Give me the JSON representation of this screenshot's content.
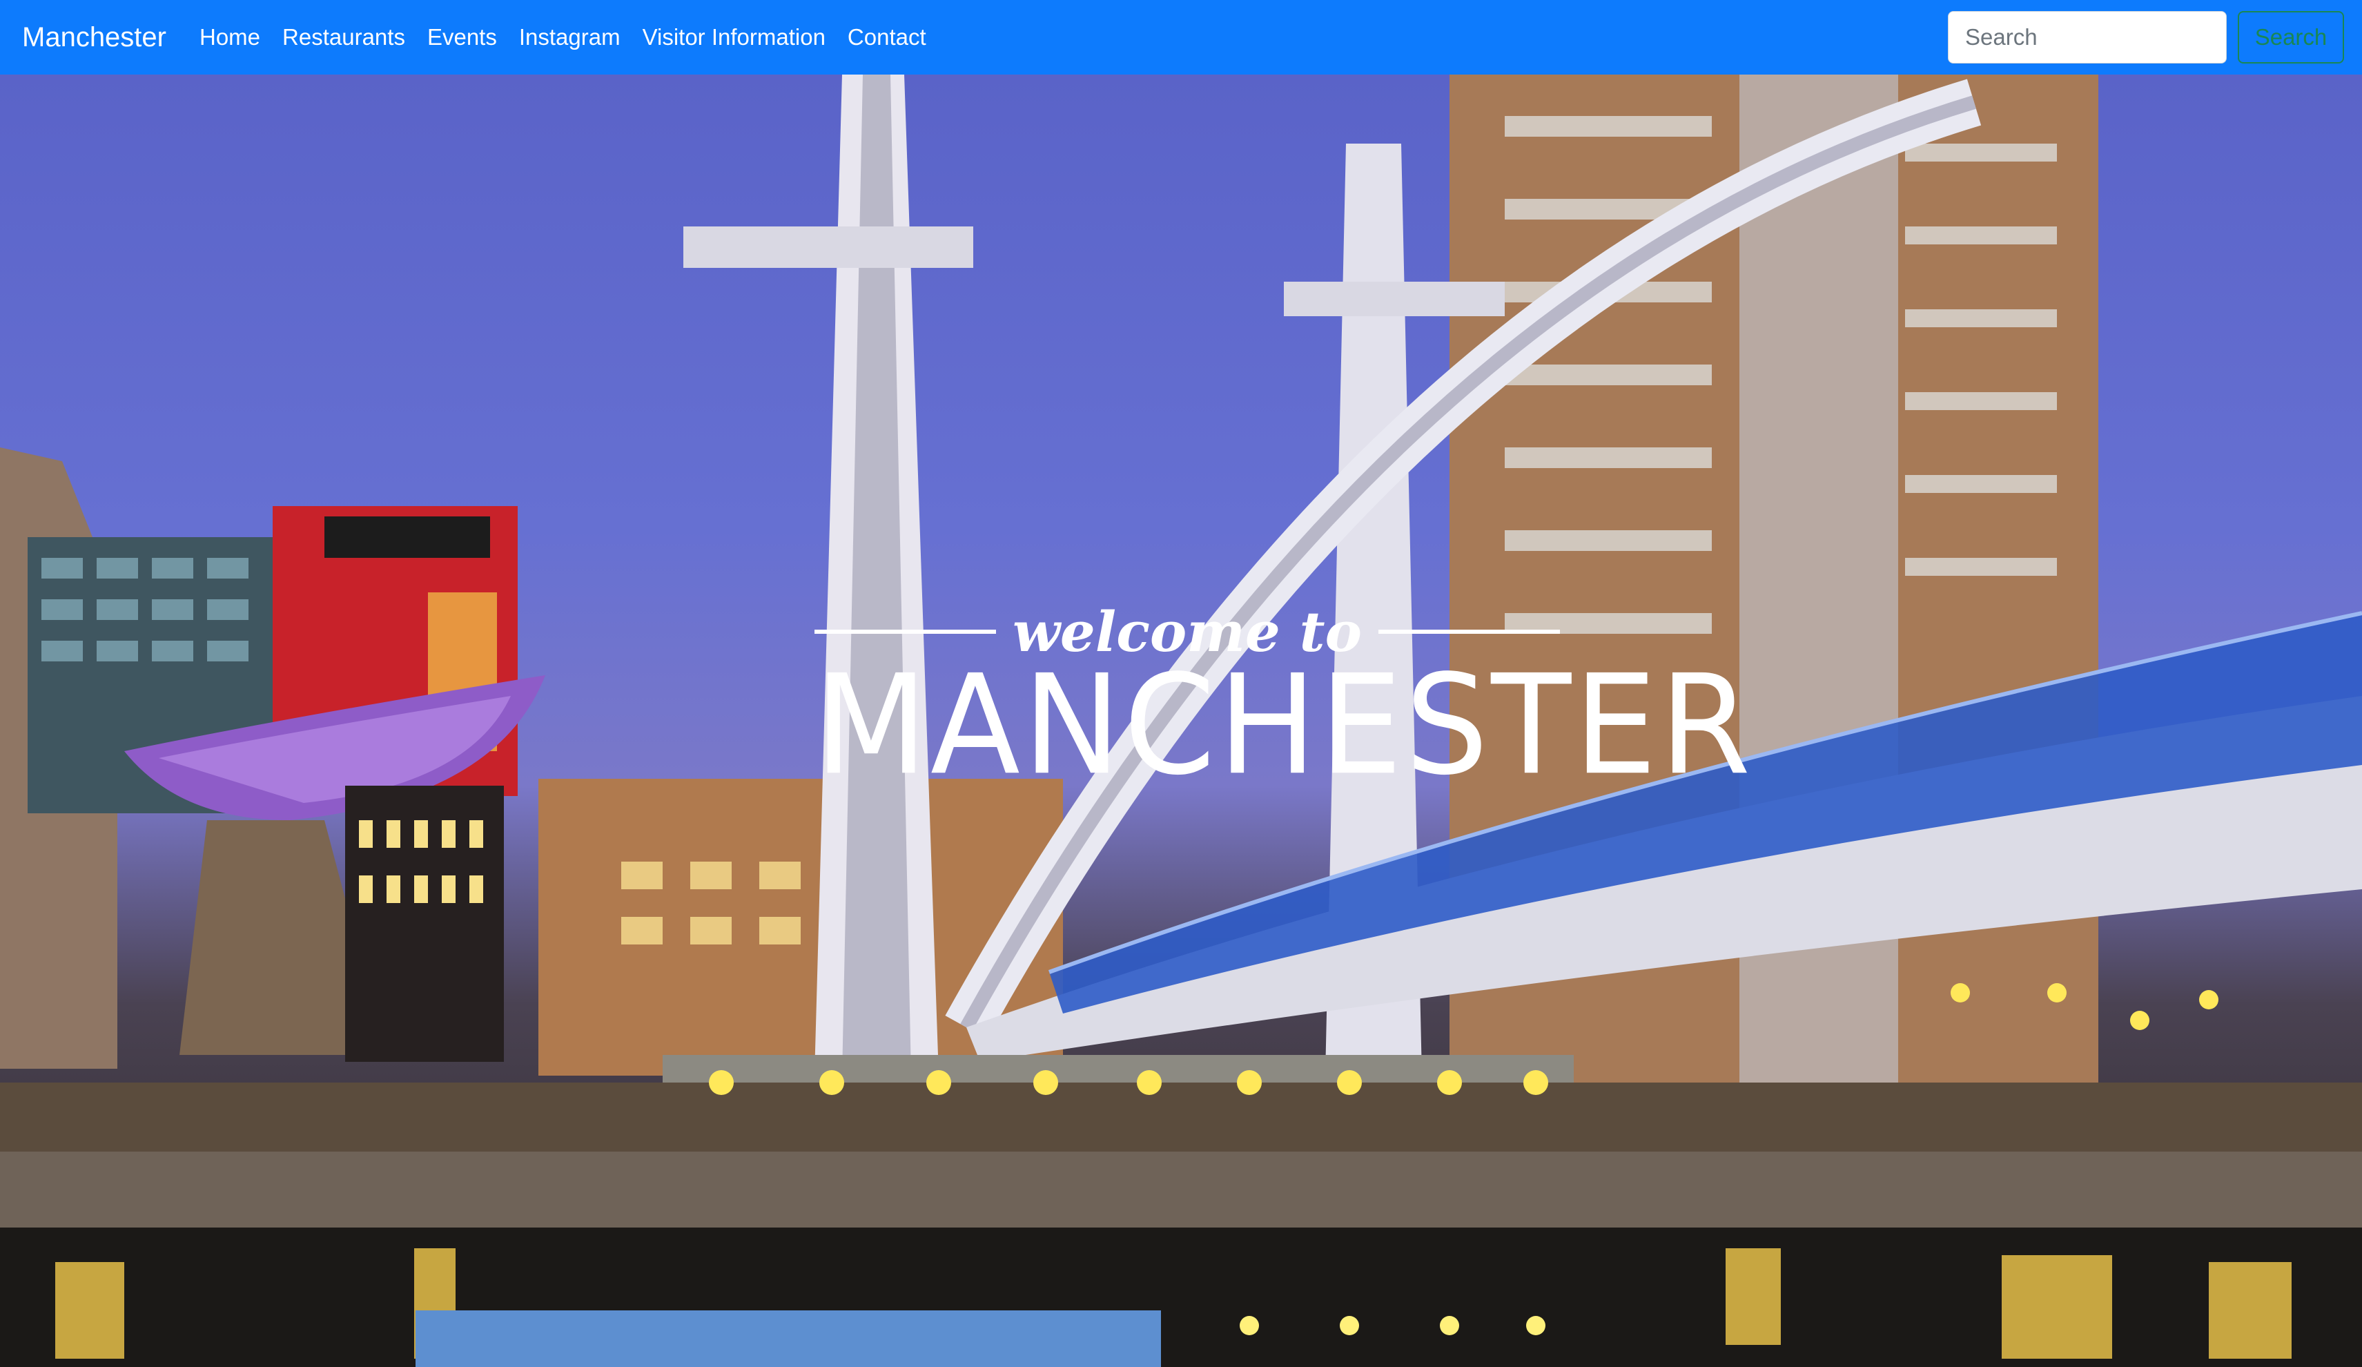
{
  "navbar": {
    "brand": "Manchester",
    "links": [
      "Home",
      "Restaurants",
      "Events",
      "Instagram",
      "Visitor Information",
      "Contact"
    ],
    "search": {
      "placeholder": "Search",
      "value": "",
      "button_label": "Search"
    }
  },
  "hero": {
    "subtitle": "welcome to",
    "title": "MANCHESTER"
  },
  "colors": {
    "navbar_bg": "#0d7bfd",
    "search_button_outline": "#198754",
    "content_card": "#5d8fd0"
  },
  "icons": {
    "hero_image": "city-bridge-night-photo"
  }
}
